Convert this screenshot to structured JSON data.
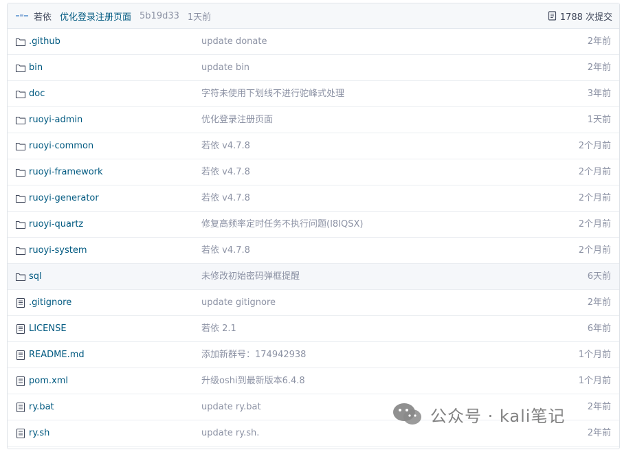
{
  "latest_commit": {
    "author": "若依",
    "message": "优化登录注册页面",
    "sha": "5b19d33",
    "time": "1天前",
    "commit_count": "1788 次提交"
  },
  "entries": [
    {
      "type": "folder",
      "name": ".github",
      "message": "update donate",
      "time": "2年前"
    },
    {
      "type": "folder",
      "name": "bin",
      "message": "update bin",
      "time": "2年前"
    },
    {
      "type": "folder",
      "name": "doc",
      "message": "字符未使用下划线不进行驼峰式处理",
      "time": "3年前"
    },
    {
      "type": "folder",
      "name": "ruoyi-admin",
      "message": "优化登录注册页面",
      "time": "1天前"
    },
    {
      "type": "folder",
      "name": "ruoyi-common",
      "message": "若依 v4.7.8",
      "time": "2个月前"
    },
    {
      "type": "folder",
      "name": "ruoyi-framework",
      "message": "若依 v4.7.8",
      "time": "2个月前"
    },
    {
      "type": "folder",
      "name": "ruoyi-generator",
      "message": "若依 v4.7.8",
      "time": "2个月前"
    },
    {
      "type": "folder",
      "name": "ruoyi-quartz",
      "message": "修复高频率定时任务不执行问题(I8IQSX)",
      "time": "2个月前"
    },
    {
      "type": "folder",
      "name": "ruoyi-system",
      "message": "若依 v4.7.8",
      "time": "2个月前"
    },
    {
      "type": "folder",
      "name": "sql",
      "message": "未修改初始密码弹框提醒",
      "time": "6天前"
    },
    {
      "type": "file",
      "name": ".gitignore",
      "message": "update gitignore",
      "time": "2年前"
    },
    {
      "type": "file",
      "name": "LICENSE",
      "message": "若依 2.1",
      "time": "6年前"
    },
    {
      "type": "file",
      "name": "README.md",
      "message": "添加新群号：174942938",
      "time": "1个月前"
    },
    {
      "type": "file",
      "name": "pom.xml",
      "message": "升级oshi到最新版本6.4.8",
      "time": "1个月前"
    },
    {
      "type": "file",
      "name": "ry.bat",
      "message": "update ry.bat",
      "time": "2年前"
    },
    {
      "type": "file",
      "name": "ry.sh",
      "message": "update ry.sh.",
      "time": "2年前"
    }
  ],
  "watermark": {
    "text": "公众号 · kali笔记",
    "icon": "wechat-icon"
  },
  "colors": {
    "link": "#005980",
    "muted": "#8c92a4",
    "border": "#dfe3e8",
    "highlight_row": "#f5f7fa"
  }
}
